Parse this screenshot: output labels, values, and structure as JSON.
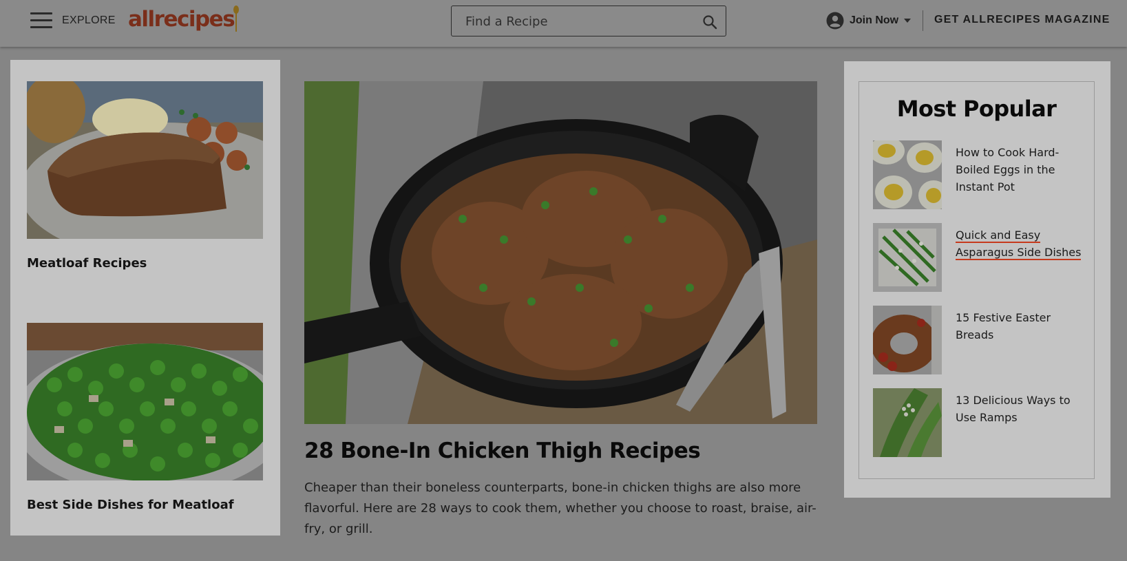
{
  "header": {
    "explore_label": "EXPLORE",
    "logo_text": "allrecipes",
    "search_placeholder": "Find a Recipe",
    "join_label": "Join Now",
    "magazine_label": "GET ALLRECIPES MAGAZINE"
  },
  "left_column": {
    "cards": [
      {
        "title": "Meatloaf Recipes"
      },
      {
        "title": "Best Side Dishes for Meatloaf"
      }
    ]
  },
  "feature": {
    "title": "28 Bone-In Chicken Thigh Recipes",
    "description": "Cheaper than their boneless counterparts, bone-in chicken thighs are also more flavorful. Here are 28 ways to cook them, whether you choose to roast, braise, air-fry, or grill."
  },
  "most_popular": {
    "title": "Most Popular",
    "items": [
      {
        "label": "How to Cook Hard-Boiled Eggs in the Instant Pot"
      },
      {
        "label": "Quick and Easy Asparagus Side Dishes"
      },
      {
        "label": "15 Festive Easter Breads"
      },
      {
        "label": "13 Delicious Ways to Use Ramps"
      }
    ]
  },
  "colors": {
    "overlay_background": "#858585",
    "card_background": "#c4c4c4",
    "accent_underline": "#c63a1d",
    "logo_color": "#7a2e1a"
  }
}
